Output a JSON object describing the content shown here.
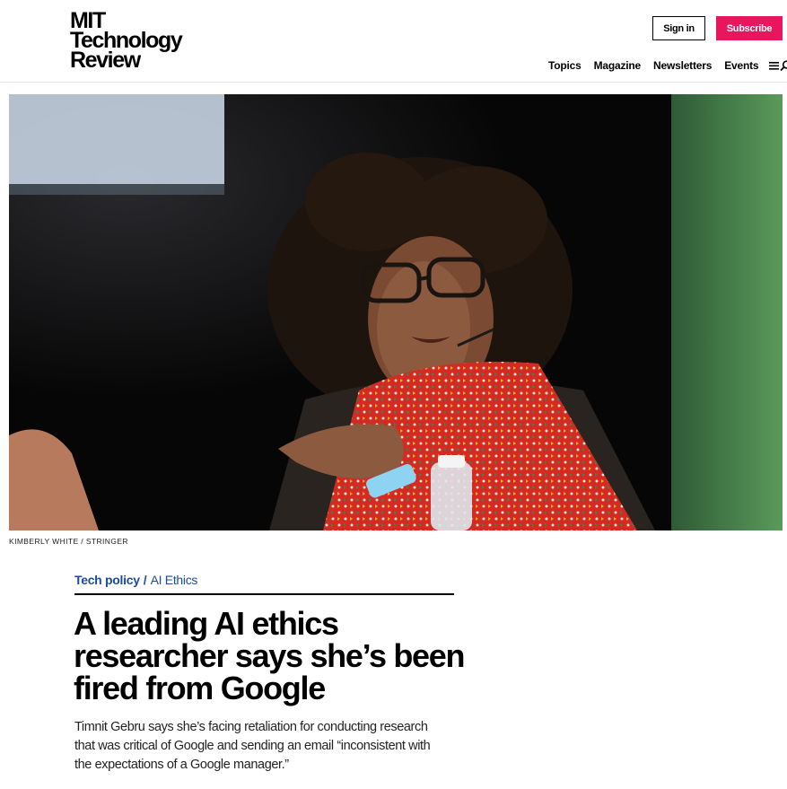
{
  "header": {
    "logo_lines": [
      "MIT",
      "Technology",
      "Review"
    ],
    "signin_label": "Sign in",
    "subscribe_label": "Subscribe",
    "nav": [
      "Topics",
      "Magazine",
      "Newsletters",
      "Events"
    ],
    "menu_icon": "menu-icon",
    "search_icon": "search-icon"
  },
  "hero": {
    "credit": "KIMBERLY WHITE / STRINGER"
  },
  "article": {
    "topic": "Tech policy",
    "tag": "AI Ethics",
    "headline": "A leading AI ethics researcher says she’s been fired from Google",
    "dek": "Timnit Gebru says she’s facing retaliation for conducting research that was critical of Google and sending an email “inconsistent with the expectations of a Google manager.”"
  },
  "colors": {
    "accent": "#e8175d",
    "link": "#1c4b9c"
  }
}
